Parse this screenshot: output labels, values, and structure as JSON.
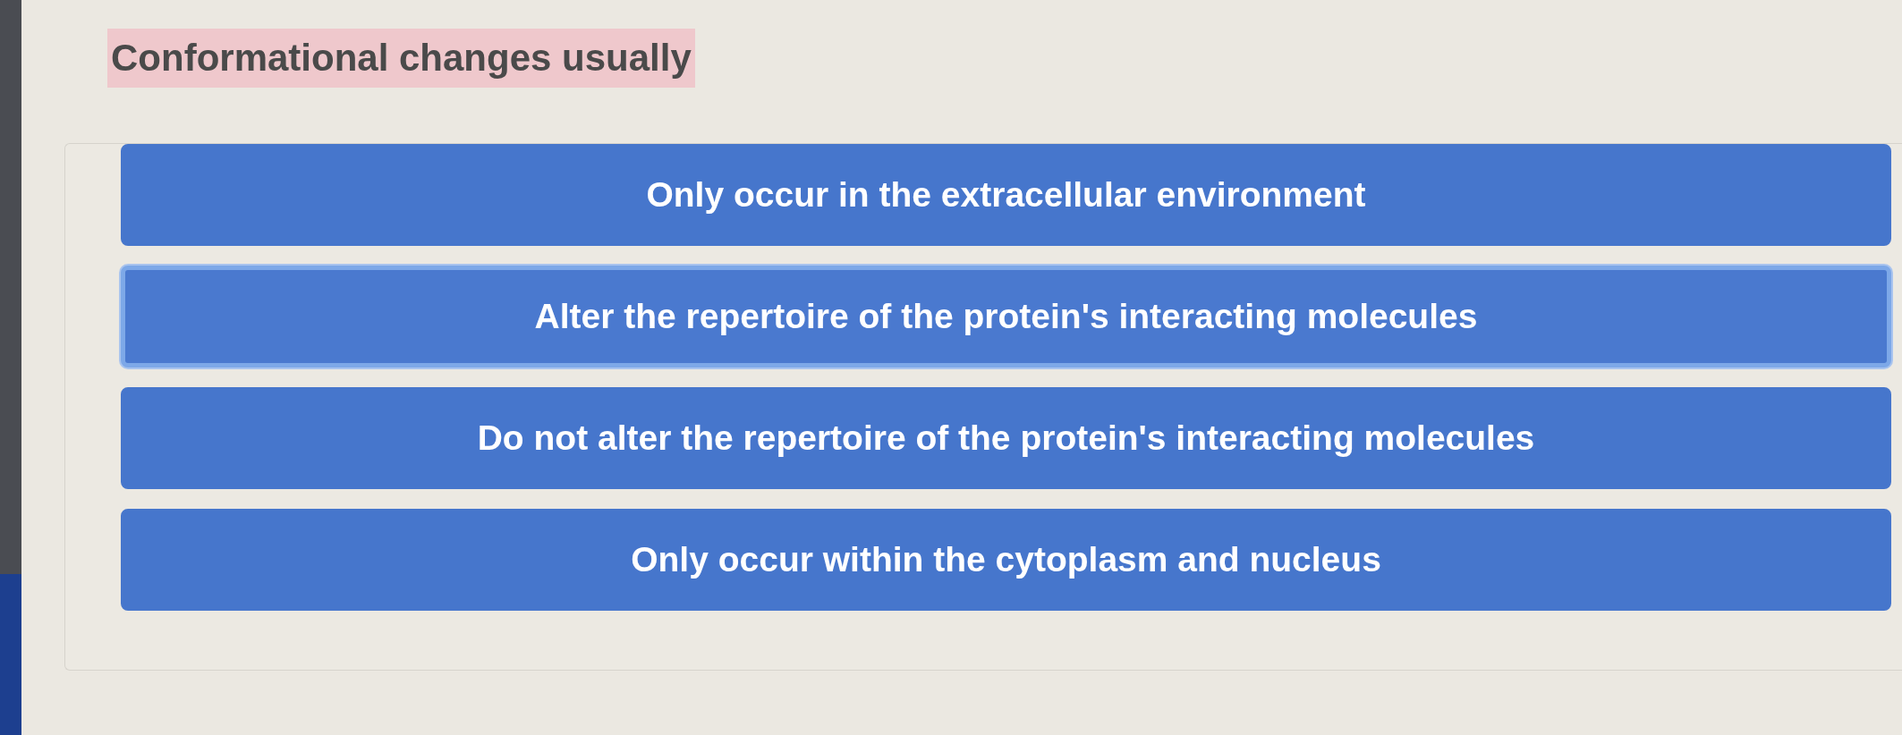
{
  "question": {
    "text": "Conformational changes usually"
  },
  "options": [
    {
      "label": "Only occur in the extracellular environment",
      "selected": false
    },
    {
      "label": "Alter the repertoire of the protein's interacting molecules",
      "selected": true
    },
    {
      "label": "Do not alter the repertoire of the protein's interacting molecules",
      "selected": false
    },
    {
      "label": "Only occur within the cytoplasm and nucleus",
      "selected": false
    }
  ]
}
